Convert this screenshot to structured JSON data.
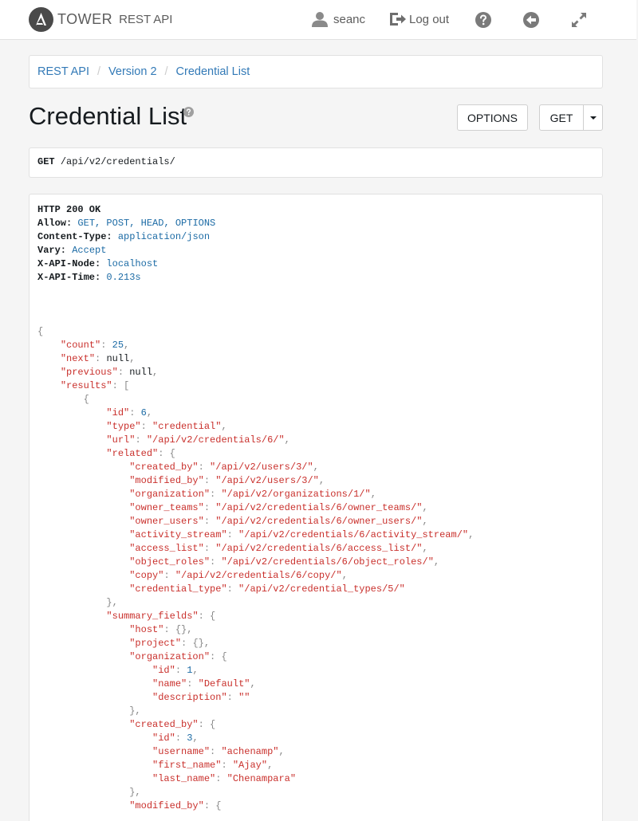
{
  "navbar": {
    "brand_tower": "TOWER",
    "brand_rest": "REST API",
    "username": "seanc",
    "logout_label": "Log out"
  },
  "breadcrumb": [
    "REST API",
    "Version 2",
    "Credential List"
  ],
  "page": {
    "title": "Credential List",
    "options_label": "OPTIONS",
    "get_label": "GET"
  },
  "request": {
    "method": "GET",
    "path": "/api/v2/credentials/"
  },
  "response": {
    "status": "HTTP 200 OK",
    "headers": [
      {
        "name": "Allow:",
        "value": "GET, POST, HEAD, OPTIONS"
      },
      {
        "name": "Content-Type:",
        "value": "application/json"
      },
      {
        "name": "Vary:",
        "value": "Accept"
      },
      {
        "name": "X-API-Node:",
        "value": "localhost"
      },
      {
        "name": "X-API-Time:",
        "value": "0.213s"
      }
    ],
    "body_lines": [
      [
        0,
        "",
        "{",
        ""
      ],
      [
        1,
        "count",
        "25",
        "num"
      ],
      [
        1,
        "next",
        "null",
        "null"
      ],
      [
        1,
        "previous",
        "null",
        "null"
      ],
      [
        1,
        "results",
        "[",
        "open"
      ],
      [
        2,
        "",
        "{",
        ""
      ],
      [
        3,
        "id",
        "6",
        "num"
      ],
      [
        3,
        "type",
        "credential",
        "str"
      ],
      [
        3,
        "url",
        "/api/v2/credentials/6/",
        "str"
      ],
      [
        3,
        "related",
        "{",
        "open"
      ],
      [
        4,
        "created_by",
        "/api/v2/users/3/",
        "str"
      ],
      [
        4,
        "modified_by",
        "/api/v2/users/3/",
        "str"
      ],
      [
        4,
        "organization",
        "/api/v2/organizations/1/",
        "str"
      ],
      [
        4,
        "owner_teams",
        "/api/v2/credentials/6/owner_teams/",
        "str"
      ],
      [
        4,
        "owner_users",
        "/api/v2/credentials/6/owner_users/",
        "str"
      ],
      [
        4,
        "activity_stream",
        "/api/v2/credentials/6/activity_stream/",
        "str"
      ],
      [
        4,
        "access_list",
        "/api/v2/credentials/6/access_list/",
        "str"
      ],
      [
        4,
        "object_roles",
        "/api/v2/credentials/6/object_roles/",
        "str"
      ],
      [
        4,
        "copy",
        "/api/v2/credentials/6/copy/",
        "str"
      ],
      [
        4,
        "credential_type",
        "/api/v2/credential_types/5/",
        "strlast"
      ],
      [
        3,
        "",
        "},",
        ""
      ],
      [
        3,
        "summary_fields",
        "{",
        "open"
      ],
      [
        4,
        "host",
        "{}",
        "emptyobj"
      ],
      [
        4,
        "project",
        "{}",
        "emptyobj"
      ],
      [
        4,
        "organization",
        "{",
        "open"
      ],
      [
        5,
        "id",
        "1",
        "num"
      ],
      [
        5,
        "name",
        "Default",
        "str"
      ],
      [
        5,
        "description",
        "",
        "strlast"
      ],
      [
        4,
        "",
        "},",
        ""
      ],
      [
        4,
        "created_by",
        "{",
        "open"
      ],
      [
        5,
        "id",
        "3",
        "num"
      ],
      [
        5,
        "username",
        "achenamp",
        "str"
      ],
      [
        5,
        "first_name",
        "Ajay",
        "str"
      ],
      [
        5,
        "last_name",
        "Chenampara",
        "strlast"
      ],
      [
        4,
        "",
        "},",
        ""
      ],
      [
        4,
        "modified_by",
        "{",
        "open"
      ]
    ]
  }
}
